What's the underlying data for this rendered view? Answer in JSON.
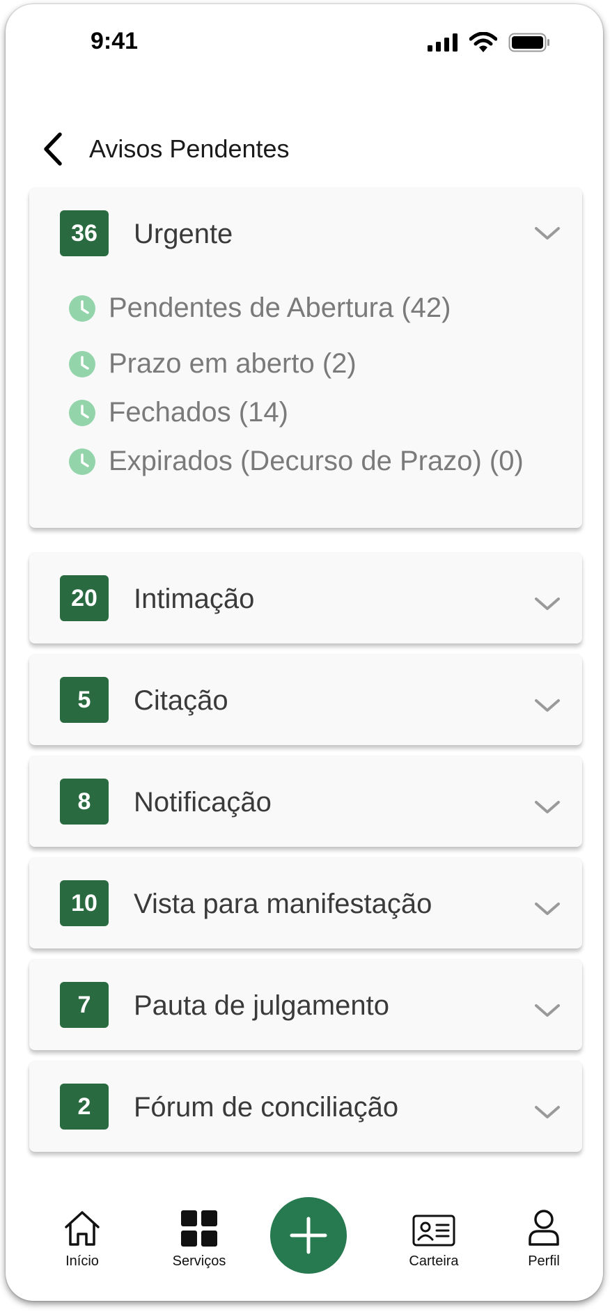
{
  "status_bar": {
    "time": "9:41"
  },
  "header": {
    "title": "Avisos Pendentes"
  },
  "cards": [
    {
      "badge": "36",
      "title": "Urgente",
      "expanded": true,
      "items": [
        {
          "label": "Pendentes de Abertura (42)"
        },
        {
          "label": "Prazo em aberto (2)"
        },
        {
          "label": "Fechados (14)"
        },
        {
          "label": "Expirados (Decurso de Prazo) (0)"
        }
      ]
    },
    {
      "badge": "20",
      "title": "Intimação"
    },
    {
      "badge": "5",
      "title": "Citação"
    },
    {
      "badge": "8",
      "title": "Notificação"
    },
    {
      "badge": "10",
      "title": "Vista para manifestação"
    },
    {
      "badge": "7",
      "title": "Pauta de julgamento"
    },
    {
      "badge": "2",
      "title": "Fórum de conciliação"
    }
  ],
  "bottom_nav": {
    "items": [
      {
        "label": "Início",
        "icon": "home-icon"
      },
      {
        "label": "Serviços",
        "icon": "grid-icon"
      },
      {
        "label": "Carteira",
        "icon": "id-card-icon"
      },
      {
        "label": "Perfil",
        "icon": "user-icon"
      }
    ],
    "fab_icon": "plus-icon"
  },
  "colors": {
    "badge": "#2a6a40",
    "fab": "#277a4f",
    "clock_icon": "#93d4ab",
    "card_bg": "#f9f9f9",
    "chevron": "#9a9a9a"
  }
}
